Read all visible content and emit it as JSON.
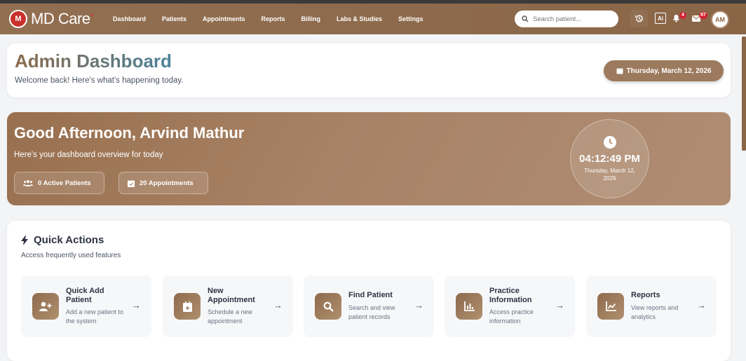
{
  "nav": {
    "brand": "MD Care",
    "brand_mark": "+",
    "links": [
      "Dashboard",
      "Patients",
      "Appointments",
      "Reports",
      "Billing",
      "Labs & Studies",
      "Settings"
    ],
    "search_placeholder": "Search patient...",
    "notifications_count": "4",
    "messages_count": "97",
    "avatar_initials": "AM"
  },
  "header": {
    "title": "Admin Dashboard",
    "subtitle": "Welcome back! Here's what's happening today.",
    "date": "Thursday, March 12, 2026"
  },
  "banner": {
    "greeting": "Good Afternoon, Arvind Mathur",
    "subtitle": "Here's your dashboard overview for today",
    "active_patients": "0 Active Patients",
    "appointments": "20 Appointments",
    "time": "04:12:49 PM",
    "date": "Thursday, March 12, 2026"
  },
  "quick_actions": {
    "title": "Quick Actions",
    "subtitle": "Access frequently used features",
    "items": [
      {
        "title": "Quick Add Patient",
        "desc": "Add a new patient to the system",
        "icon": "user-plus-icon"
      },
      {
        "title": "New Appointment",
        "desc": "Schedule a new appointment",
        "icon": "calendar-plus-icon"
      },
      {
        "title": "Find Patient",
        "desc": "Search and view patient records",
        "icon": "search-icon"
      },
      {
        "title": "Practice Information",
        "desc": "Access practice information",
        "icon": "chart-icon"
      },
      {
        "title": "Reports",
        "desc": "View reports and analytics",
        "icon": "line-chart-icon"
      }
    ]
  }
}
